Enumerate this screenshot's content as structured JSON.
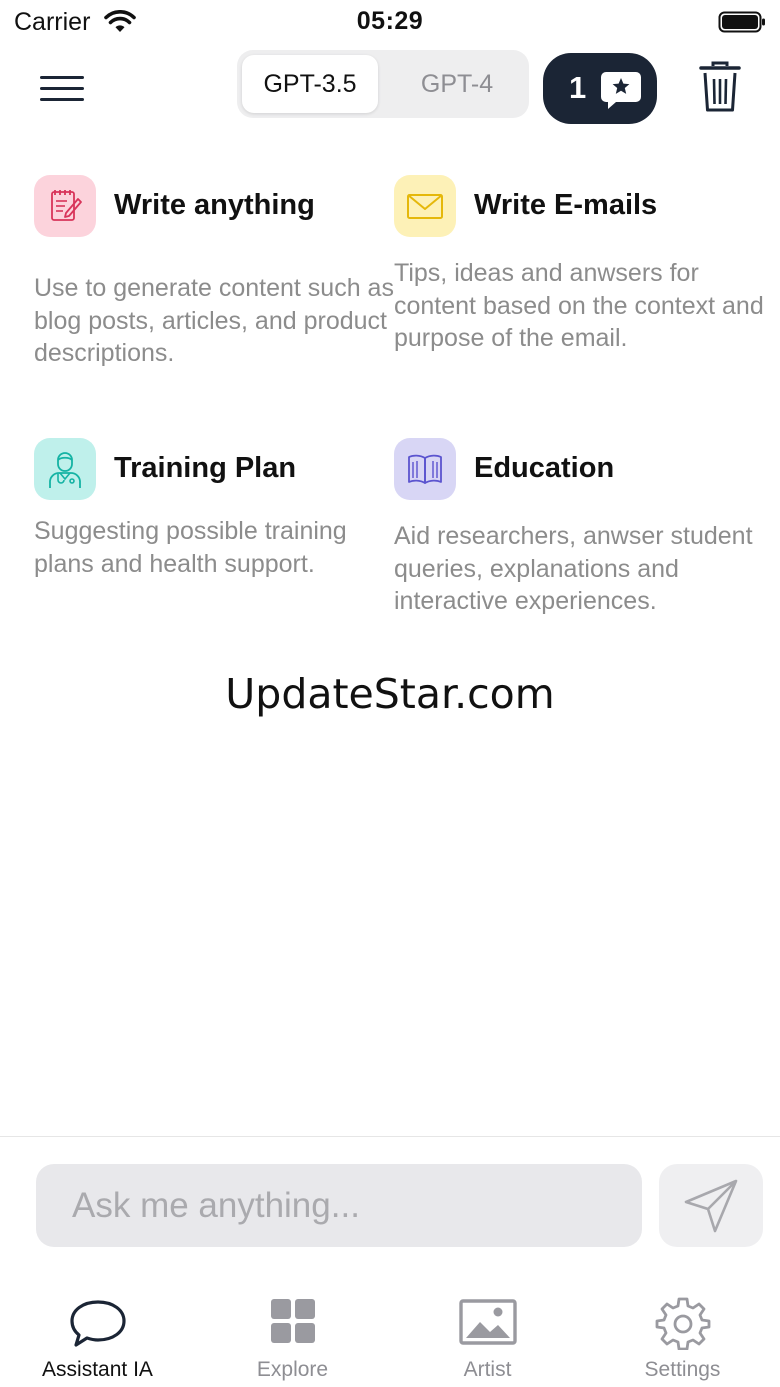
{
  "status_bar": {
    "carrier": "Carrier",
    "time": "05:29"
  },
  "header": {
    "models": [
      "GPT-3.5",
      "GPT-4"
    ],
    "selected_model": "GPT-3.5",
    "credits": "1",
    "badge_color": "#1b2535"
  },
  "cards": [
    {
      "title": "Write anything",
      "description": "Use to generate content such as blog posts, articles, and product descriptions.",
      "icon": "notepad-pen-icon",
      "icon_bg": "#fcd3dc"
    },
    {
      "title": "Write E-mails",
      "description": "Tips, ideas and anwsers for content based on the context and purpose of the email.",
      "icon": "envelope-icon",
      "icon_bg": "#fdf1b7"
    },
    {
      "title": "Training Plan",
      "description": "Suggesting possible training plans and health support.",
      "icon": "doctor-icon",
      "icon_bg": "#bff0eb"
    },
    {
      "title": "Education",
      "description": "Aid researchers, anwser student queries, explanations and interactive experiences.",
      "icon": "open-book-icon",
      "icon_bg": "#d8d6f5"
    }
  ],
  "watermark": "UpdateStar.com",
  "composer": {
    "placeholder": "Ask me anything..."
  },
  "tabs": [
    {
      "label": "Assistant IA",
      "icon": "chat-bubble-icon",
      "active": true
    },
    {
      "label": "Explore",
      "icon": "grid-icon",
      "active": false
    },
    {
      "label": "Artist",
      "icon": "image-icon",
      "active": false
    },
    {
      "label": "Settings",
      "icon": "gear-icon",
      "active": false
    }
  ]
}
